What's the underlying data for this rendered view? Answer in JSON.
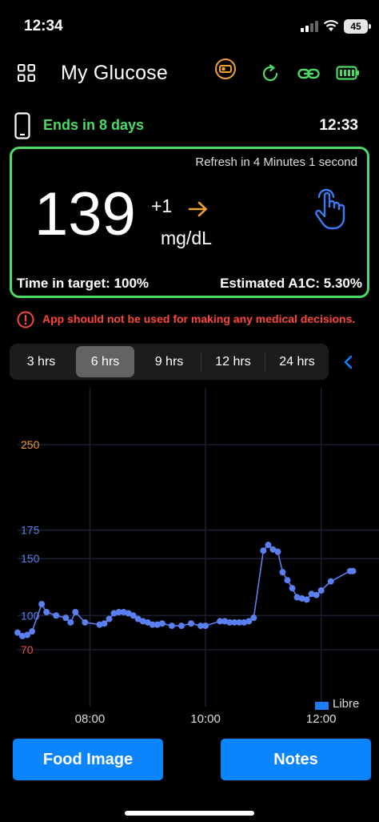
{
  "status_bar": {
    "time": "12:34",
    "battery": "45"
  },
  "header": {
    "title": "My Glucose",
    "icons": [
      "grid-menu-icon",
      "sensor-icon",
      "refresh-icon",
      "link-icon",
      "battery-icon"
    ]
  },
  "sensor": {
    "ends_label": "Ends in  8 days",
    "time": "12:33"
  },
  "reading": {
    "refresh_text": "Refresh in 4 Minutes 1 second",
    "value": "139",
    "delta": "+1",
    "trend": "arrow-right-icon",
    "unit": "mg/dL",
    "time_in_target": "Time in target: 100%",
    "estimated_a1c": "Estimated A1C: 5.30%"
  },
  "warning": "App should not be used for making any medical decisions.",
  "ranges": {
    "tabs": [
      "3 hrs",
      "6 hrs",
      "9 hrs",
      "12 hrs",
      "24 hrs"
    ],
    "selected": "6 hrs"
  },
  "colors": {
    "accent": "#4cd964",
    "button": "#0a84ff",
    "line": "#5b7ff0",
    "high": "#f0a030",
    "low": "#e85050",
    "warning": "#ff453a"
  },
  "chart_data": {
    "type": "line",
    "xlabel": "",
    "ylabel": "",
    "x_ticks": [
      "08:00",
      "10:00",
      "12:00"
    ],
    "y_ticks": [
      {
        "value": 250,
        "label": "250",
        "color": "#f0a030"
      },
      {
        "value": 175,
        "label": "175",
        "color": "#5b7ff0"
      },
      {
        "value": 150,
        "label": "150",
        "color": "#5b7ff0"
      },
      {
        "value": 100,
        "label": "100",
        "color": "#5b7ff0"
      },
      {
        "value": 70,
        "label": "70",
        "color": "#e85050"
      }
    ],
    "x_range": [
      "06:45",
      "13:00"
    ],
    "ylim": [
      20,
      300
    ],
    "legend": "Libre",
    "series": [
      {
        "name": "Libre",
        "points": [
          [
            "06:45",
            85
          ],
          [
            "06:50",
            82
          ],
          [
            "06:55",
            83
          ],
          [
            "07:00",
            86
          ],
          [
            "07:10",
            110
          ],
          [
            "07:15",
            103
          ],
          [
            "07:25",
            100
          ],
          [
            "07:35",
            98
          ],
          [
            "07:40",
            94
          ],
          [
            "07:45",
            103
          ],
          [
            "07:55",
            94
          ],
          [
            "08:10",
            92
          ],
          [
            "08:15",
            93
          ],
          [
            "08:20",
            97
          ],
          [
            "08:25",
            102
          ],
          [
            "08:30",
            103
          ],
          [
            "08:35",
            103
          ],
          [
            "08:40",
            102
          ],
          [
            "08:45",
            100
          ],
          [
            "08:50",
            97
          ],
          [
            "08:55",
            95
          ],
          [
            "09:00",
            94
          ],
          [
            "09:05",
            92
          ],
          [
            "09:10",
            92
          ],
          [
            "09:15",
            93
          ],
          [
            "09:25",
            91
          ],
          [
            "09:35",
            91
          ],
          [
            "09:45",
            93
          ],
          [
            "09:55",
            91
          ],
          [
            "10:00",
            91
          ],
          [
            "10:15",
            95
          ],
          [
            "10:20",
            95
          ],
          [
            "10:25",
            94
          ],
          [
            "10:30",
            94
          ],
          [
            "10:35",
            94
          ],
          [
            "10:40",
            94
          ],
          [
            "10:45",
            95
          ],
          [
            "10:50",
            98
          ],
          [
            "11:00",
            157
          ],
          [
            "11:05",
            162
          ],
          [
            "11:10",
            158
          ],
          [
            "11:15",
            156
          ],
          [
            "11:20",
            138
          ],
          [
            "11:25",
            131
          ],
          [
            "11:30",
            124
          ],
          [
            "11:35",
            116
          ],
          [
            "11:40",
            115
          ],
          [
            "11:45",
            114
          ],
          [
            "11:50",
            119
          ],
          [
            "11:55",
            118
          ],
          [
            "12:00",
            122
          ],
          [
            "12:10",
            130
          ],
          [
            "12:30",
            139
          ],
          [
            "12:33",
            139
          ]
        ]
      }
    ]
  },
  "buttons": {
    "food": "Food Image",
    "notes": "Notes"
  }
}
